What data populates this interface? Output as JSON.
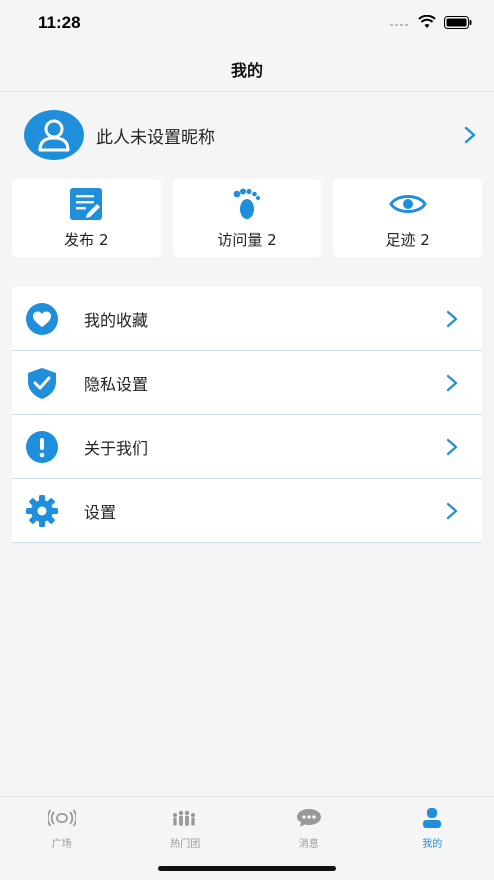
{
  "status_bar": {
    "time": "11:28"
  },
  "nav": {
    "title": "我的"
  },
  "profile": {
    "nickname": "此人未设置昵称"
  },
  "stats": [
    {
      "label": "发布 2",
      "icon": "edit-document-icon"
    },
    {
      "label": "访问量 2",
      "icon": "footprint-icon"
    },
    {
      "label": "足迹 2",
      "icon": "eye-icon"
    }
  ],
  "menu": [
    {
      "label": "我的收藏",
      "icon": "heart-icon"
    },
    {
      "label": "隐私设置",
      "icon": "shield-check-icon"
    },
    {
      "label": "关于我们",
      "icon": "info-exclamation-icon"
    },
    {
      "label": "设置",
      "icon": "gear-icon"
    }
  ],
  "tabs": [
    {
      "label": "广场",
      "icon": "broadcast-icon",
      "active": false
    },
    {
      "label": "热门团",
      "icon": "group-icon",
      "active": false
    },
    {
      "label": "消息",
      "icon": "chat-bubble-icon",
      "active": false
    },
    {
      "label": "我的",
      "icon": "person-icon",
      "active": true
    }
  ],
  "colors": {
    "accent": "#1f8fdc",
    "inactive": "#999999",
    "background": "#f5f5f5"
  }
}
